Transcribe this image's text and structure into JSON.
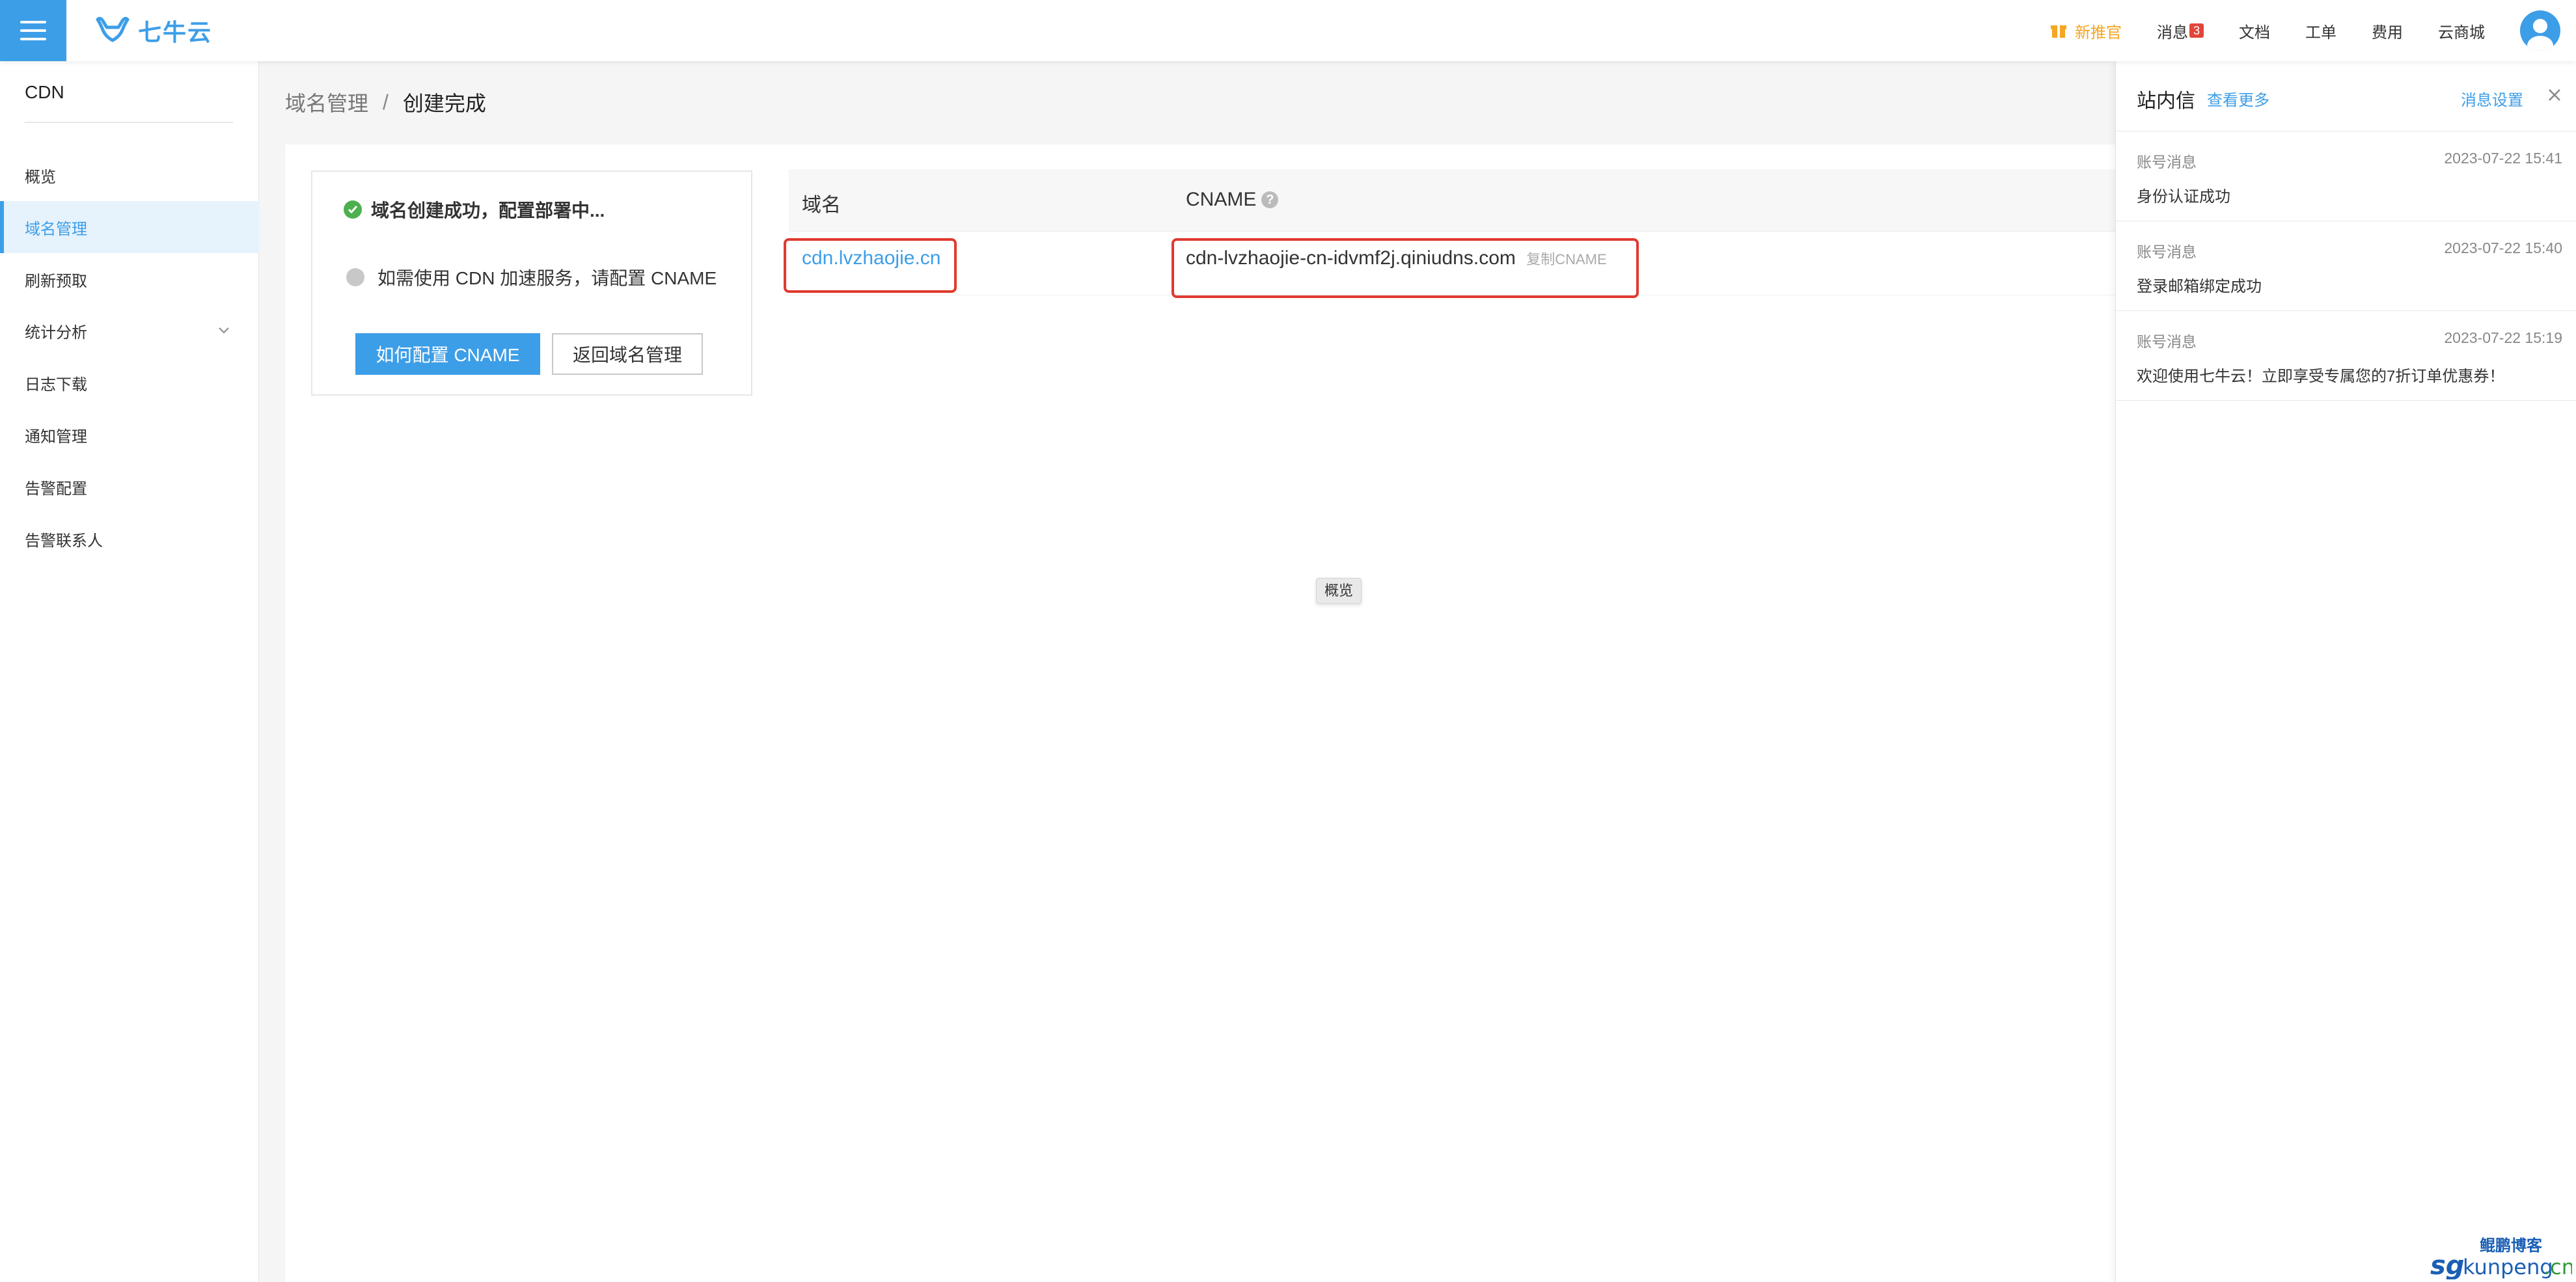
{
  "topbar": {
    "logo_text": "七牛云",
    "nav": {
      "promo": "新推官",
      "messages": "消息",
      "message_count": "3",
      "docs": "文档",
      "tickets": "工单",
      "billing": "费用",
      "marketplace": "云商城"
    }
  },
  "sidebar": {
    "title": "CDN",
    "items": [
      {
        "label": "概览"
      },
      {
        "label": "域名管理"
      },
      {
        "label": "刷新预取"
      },
      {
        "label": "统计分析"
      },
      {
        "label": "日志下载"
      },
      {
        "label": "通知管理"
      },
      {
        "label": "告警配置"
      },
      {
        "label": "告警联系人"
      }
    ]
  },
  "breadcrumb": {
    "parent": "域名管理",
    "separator": "/",
    "current": "创建完成"
  },
  "status": {
    "success_text": "域名创建成功，配置部署中...",
    "cname_hint": "如需使用 CDN 加速服务，请配置 CNAME",
    "primary_button": "如何配置 CNAME",
    "back_button": "返回域名管理"
  },
  "table": {
    "headers": {
      "domain": "域名",
      "cname": "CNAME"
    },
    "row": {
      "domain": "cdn.lvzhaojie.cn",
      "cname": "cdn-lvzhaojie-cn-idvmf2j.qiniudns.com",
      "copy_label": "复制CNAME"
    }
  },
  "tooltip": "概览",
  "notifications": {
    "title": "站内信",
    "more": "查看更多",
    "settings": "消息设置",
    "items": [
      {
        "type": "账号消息",
        "time": "2023-07-22 15:41",
        "text": "身份认证成功"
      },
      {
        "type": "账号消息",
        "time": "2023-07-22 15:40",
        "text": "登录邮箱绑定成功"
      },
      {
        "type": "账号消息",
        "time": "2023-07-22 15:19",
        "text": "欢迎使用七牛云！立即享受专属您的7折订单优惠券！"
      }
    ]
  },
  "watermark": {
    "brand": "鲲鹏博客",
    "url_prefix": "sg",
    "url_main": "kunpeng",
    "url_suffix": ".cn"
  },
  "colors": {
    "accent": "#3d9ee8",
    "success": "#4cb04e",
    "highlight": "#e03a2f",
    "promo": "#f5a623"
  }
}
